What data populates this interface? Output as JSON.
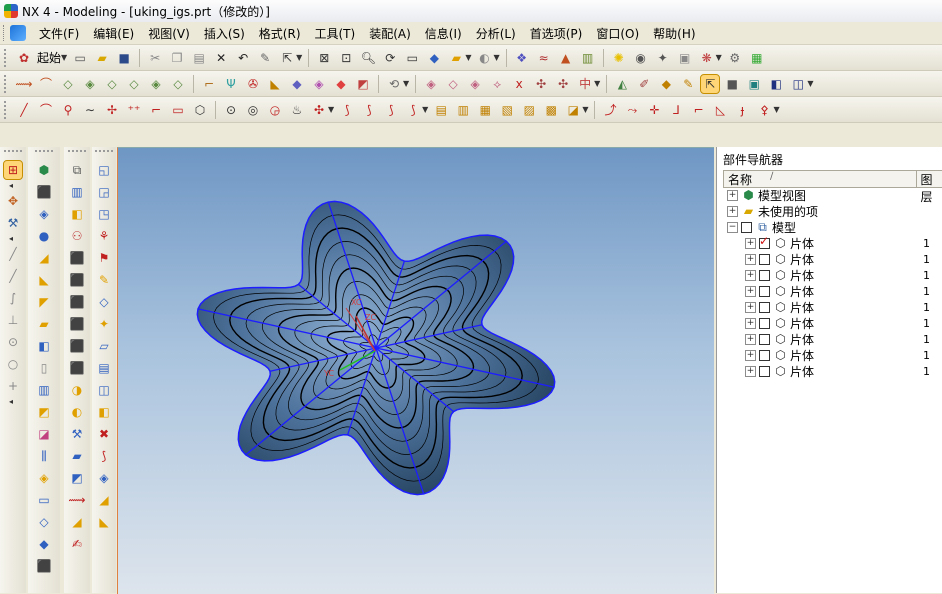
{
  "window": {
    "title": "NX 4 - Modeling - [uking_igs.prt（修改的）]"
  },
  "menubar": {
    "items": [
      {
        "label": "文件(F)"
      },
      {
        "label": "编辑(E)"
      },
      {
        "label": "视图(V)"
      },
      {
        "label": "插入(S)"
      },
      {
        "label": "格式(R)"
      },
      {
        "label": "工具(T)"
      },
      {
        "label": "装配(A)"
      },
      {
        "label": "信息(I)"
      },
      {
        "label": "分析(L)"
      },
      {
        "label": "首选项(P)"
      },
      {
        "label": "窗口(O)"
      },
      {
        "label": "帮助(H)"
      }
    ]
  },
  "toolbar": {
    "start_label": "起始",
    "row1_icons": [
      "new-file-icon",
      "open-file-icon",
      "save-icon",
      "cut-icon",
      "copy-icon",
      "paste-icon",
      "delete-icon",
      "undo-icon",
      "edit-icon",
      "select-icon",
      "fit-view-icon",
      "zoom-window-icon",
      "zoom-icon",
      "rotate-icon",
      "pan-icon",
      "shaded-view-icon",
      "render-style-icon",
      "display-icon",
      "layer-icon",
      "wave-icon",
      "fill-icon",
      "bulb-icon",
      "camera-icon",
      "paint-icon",
      "texture-icon",
      "light-icon",
      "analysis-icon"
    ],
    "row2_icons": [
      "curve-feature-icon",
      "sketch-icon",
      "extrude-icon",
      "revolve-icon",
      "sweep-icon",
      "surface-icon",
      "blend-icon",
      "chamfer-icon",
      "shell-icon",
      "hole-icon",
      "boss-icon",
      "pocket-icon",
      "pad-icon",
      "slot-icon",
      "groove-icon",
      "thread-icon",
      "trim-icon",
      "split-icon",
      "sew-icon",
      "mirror-icon",
      "pattern-icon",
      "measure-icon",
      "section-icon",
      "offset-icon",
      "face-icon",
      "select-face-icon",
      "shade-icon",
      "edge-icon",
      "color-icon"
    ],
    "row3_icons": [
      "line-icon",
      "arc-icon",
      "circle-icon",
      "spline-icon",
      "point-icon",
      "point-set-icon",
      "fillet-icon",
      "rectangle-icon",
      "polygon-icon",
      "ellipse-icon",
      "helix-icon",
      "offset-curve-icon",
      "bridge-icon",
      "project-icon",
      "intersect-icon",
      "join-icon",
      "extract-icon",
      "wrap-icon",
      "isoparam-icon",
      "section-curve-icon",
      "simplify-icon",
      "edit-curve-icon",
      "trim-curve-icon",
      "divide-icon",
      "stretch-icon",
      "length-icon",
      "corner-icon"
    ]
  },
  "navigator": {
    "title": "部件导航器",
    "col_name": "名称",
    "col_layer": "图层",
    "nodes": [
      {
        "label": "模型视图",
        "layer": ""
      },
      {
        "label": "未使用的项",
        "layer": ""
      },
      {
        "label": "模型",
        "layer": ""
      },
      {
        "label": "片体",
        "layer": "1"
      },
      {
        "label": "片体",
        "layer": "1"
      },
      {
        "label": "片体",
        "layer": "1"
      },
      {
        "label": "片体",
        "layer": "1"
      },
      {
        "label": "片体",
        "layer": "1"
      },
      {
        "label": "片体",
        "layer": "1"
      },
      {
        "label": "片体",
        "layer": "1"
      },
      {
        "label": "片体",
        "layer": "1"
      },
      {
        "label": "片体",
        "layer": "1"
      }
    ]
  },
  "viewport": {
    "model": "six-lobed-star-surface",
    "axis_labels": [
      "XC",
      "ZC",
      "YC"
    ],
    "colors": {
      "surface": "#3a5f86",
      "edges": "#1d1dff",
      "contours": "#000000",
      "bg_top": "#6f97c4",
      "bg_bottom": "#dde4ec"
    }
  }
}
